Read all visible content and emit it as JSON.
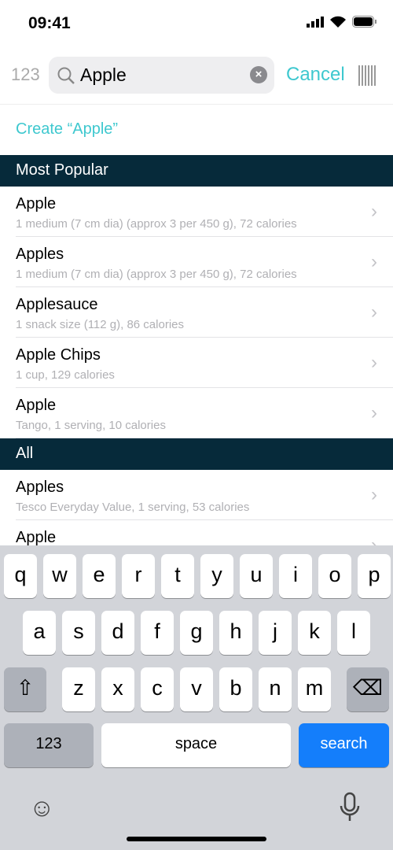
{
  "status": {
    "time": "09:41"
  },
  "search": {
    "prefix": "123",
    "query": "Apple",
    "cancel": "Cancel"
  },
  "create_label": "Create “Apple”",
  "sections": [
    {
      "title": "Most Popular",
      "items": [
        {
          "title": "Apple",
          "subtitle": "1 medium (7 cm dia) (approx 3 per 450 g), 72 calories"
        },
        {
          "title": "Apples",
          "subtitle": "1 medium (7 cm dia) (approx 3 per 450 g), 72 calories"
        },
        {
          "title": "Applesauce",
          "subtitle": "1 snack size (112 g), 86 calories"
        },
        {
          "title": "Apple Chips",
          "subtitle": "1 cup, 129 calories"
        },
        {
          "title": "Apple",
          "subtitle": "Tango, 1 serving, 10 calories"
        }
      ]
    },
    {
      "title": "All",
      "items": [
        {
          "title": "Apples",
          "subtitle": "Tesco Everyday Value, 1 serving, 53 calories"
        },
        {
          "title": "Apple",
          "subtitle": ""
        }
      ]
    }
  ],
  "keyboard": {
    "rows": [
      "qwertyuiop",
      "asdfghjkl",
      "zxcvbnm"
    ],
    "numbers": "123",
    "space": "space",
    "search": "search"
  },
  "colors": {
    "accent": "#3ec8cf",
    "section": "#062a3a",
    "search_key": "#147efb"
  }
}
